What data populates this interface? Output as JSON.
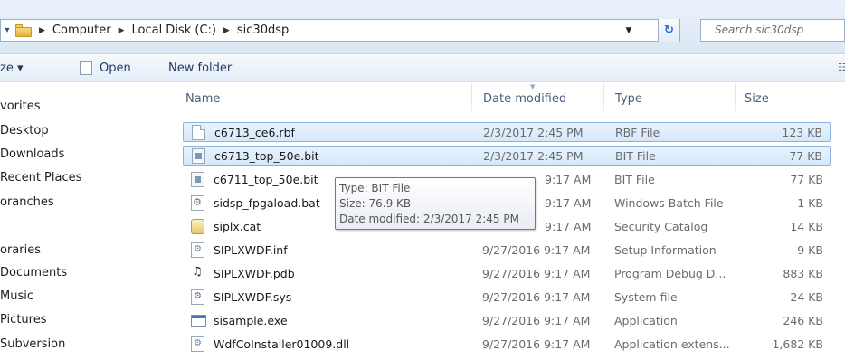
{
  "address_bar": {
    "crumbs": [
      "Computer",
      "Local Disk (C:)",
      "sic30dsp"
    ],
    "search_placeholder": "Search sic30dsp"
  },
  "toolbar": {
    "organize_label": "ze ▾",
    "open_label": "Open",
    "new_folder_label": "New folder"
  },
  "nav": {
    "items": [
      "vorites",
      "Desktop",
      "Downloads",
      "Recent Places",
      "oranches",
      "oraries",
      "Documents",
      "Music",
      "Pictures",
      "Subversion"
    ]
  },
  "columns": {
    "name": "Name",
    "date": "Date modified",
    "type": "Type",
    "size": "Size"
  },
  "files": [
    {
      "name": "c6713_ce6.rbf",
      "date": "2/3/2017 2:45 PM",
      "type": "RBF File",
      "size": "123 KB",
      "icon": "document-icon",
      "selected": true
    },
    {
      "name": "c6713_top_50e.bit",
      "date": "2/3/2017 2:45 PM",
      "type": "BIT File",
      "size": "77 KB",
      "icon": "bit-file-icon",
      "selected": true
    },
    {
      "name": "c6711_top_50e.bit",
      "date": "9:17 AM",
      "type": "BIT File",
      "size": "77 KB",
      "icon": "bit-file-icon",
      "selected": false
    },
    {
      "name": "sidsp_fpgaload.bat",
      "date": "9:17 AM",
      "type": "Windows Batch File",
      "size": "1 KB",
      "icon": "batch-file-icon",
      "selected": false
    },
    {
      "name": "siplx.cat",
      "date": "9:17 AM",
      "type": "Security Catalog",
      "size": "14 KB",
      "icon": "security-catalog-icon",
      "selected": false
    },
    {
      "name": "SIPLXWDF.inf",
      "date": "9/27/2016 9:17 AM",
      "type": "Setup Information",
      "size": "9 KB",
      "icon": "setup-info-icon",
      "selected": false
    },
    {
      "name": "SIPLXWDF.pdb",
      "date": "9/27/2016 9:17 AM",
      "type": "Program Debug D...",
      "size": "883 KB",
      "icon": "debug-database-icon",
      "selected": false
    },
    {
      "name": "SIPLXWDF.sys",
      "date": "9/27/2016 9:17 AM",
      "type": "System file",
      "size": "24 KB",
      "icon": "system-file-icon",
      "selected": false
    },
    {
      "name": "sisample.exe",
      "date": "9/27/2016 9:17 AM",
      "type": "Application",
      "size": "246 KB",
      "icon": "application-icon",
      "selected": false
    },
    {
      "name": "WdfCoInstaller01009.dll",
      "date": "9/27/2016 9:17 AM",
      "type": "Application extens...",
      "size": "1,682 KB",
      "icon": "dll-file-icon",
      "selected": false
    }
  ],
  "tooltip": {
    "line1": "Type: BIT File",
    "line2": "Size: 76.9 KB",
    "line3": "Date modified: 2/3/2017 2:45 PM"
  }
}
